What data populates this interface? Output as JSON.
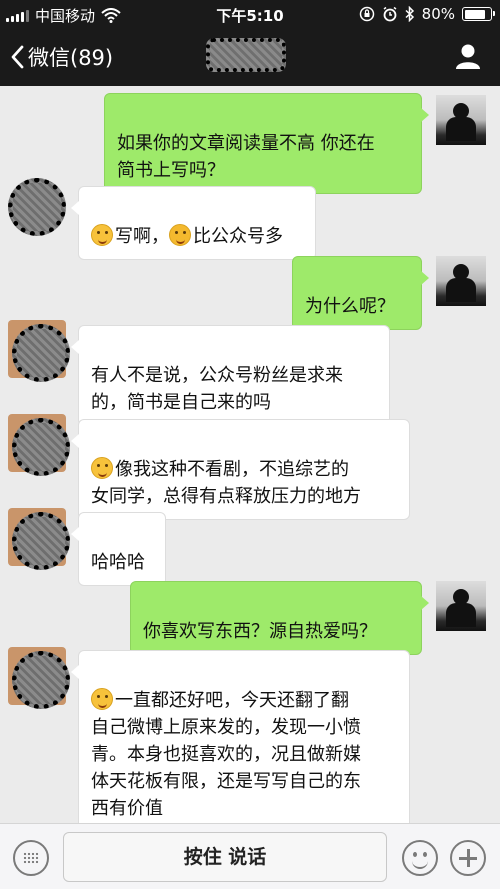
{
  "status_bar": {
    "carrier": "中国移动",
    "time": "下午5:10",
    "battery": "80%",
    "battery_level": 0.8,
    "icons": [
      "signal-icon",
      "wifi-icon",
      "orientation-lock-icon",
      "alarm-icon",
      "bluetooth-icon",
      "battery-icon"
    ]
  },
  "nav": {
    "back_label": "微信(89)",
    "icons": [
      "chevron-left-icon",
      "person-icon"
    ]
  },
  "messages": [
    {
      "from": "me",
      "text": "如果你的文章阅读量不高 你还在\n简书上写吗？"
    },
    {
      "from": "them",
      "emoji_1": "dizzy-face-emoji",
      "text_1": "写啊，",
      "emoji_2": "crying-face-emoji",
      "text_2": "比公众号多"
    },
    {
      "from": "me",
      "text": "为什么呢？"
    },
    {
      "from": "them",
      "text": "有人不是说，公众号粉丝是求来\n的，简书是自己来的吗"
    },
    {
      "from": "them",
      "emoji_1": "laughing-tears-emoji",
      "text_1": "像我这种不看剧，不追综艺的\n女同学，总得有点释放压力的地方"
    },
    {
      "from": "them",
      "text": "哈哈哈"
    },
    {
      "from": "me",
      "text": "你喜欢写东西？源自热爱吗？"
    },
    {
      "from": "them",
      "emoji_1": "dizzy-face-emoji",
      "text_1": "一直都还好吧，今天还翻了翻\n自己微博上原来发的，发现一小愤\n青。本身也挺喜欢的，况且做新媒\n体天花板有限，还是写写自己的东\n西有价值"
    }
  ],
  "input_bar": {
    "voice_label": "按住 说话",
    "icons": [
      "keyboard-icon",
      "emoji-icon",
      "plus-icon"
    ]
  }
}
